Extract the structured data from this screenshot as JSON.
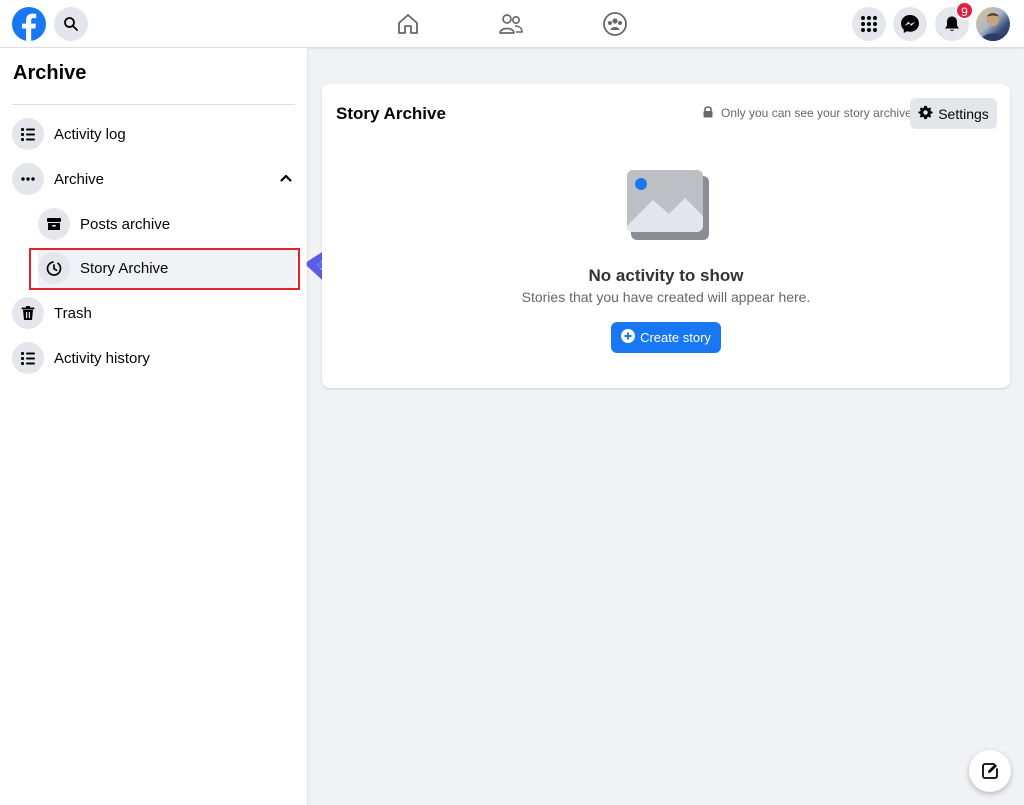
{
  "topbar": {
    "icons": [
      "facebook-logo-icon",
      "search-icon",
      "home-icon",
      "friends-icon",
      "groups-icon",
      "menu-grid-icon",
      "messenger-icon",
      "bell-icon"
    ],
    "notification_count": "9",
    "accent": "#1877f2",
    "badge_color": "#e41e3f"
  },
  "sidebar": {
    "title": "Archive",
    "items": [
      {
        "label": "Activity log",
        "icon": "list-icon"
      },
      {
        "label": "Archive",
        "icon": "more-dots-icon",
        "expanded": true
      },
      {
        "label": "Posts archive",
        "icon": "archive-box-icon"
      },
      {
        "label": "Story Archive",
        "icon": "clock-icon",
        "selected": true
      },
      {
        "label": "Trash",
        "icon": "trash-icon"
      },
      {
        "label": "Activity history",
        "icon": "list-icon"
      }
    ]
  },
  "main": {
    "card_title": "Story Archive",
    "privacy_note": "Only you can see your story archive",
    "settings_label": "Settings",
    "empty_title": "No activity to show",
    "empty_subtitle": "Stories that you have created will appear here.",
    "create_label": "Create story"
  },
  "annotation": {
    "highlight_color": "#e0242c",
    "arrow_color": "#6b6ef0"
  }
}
